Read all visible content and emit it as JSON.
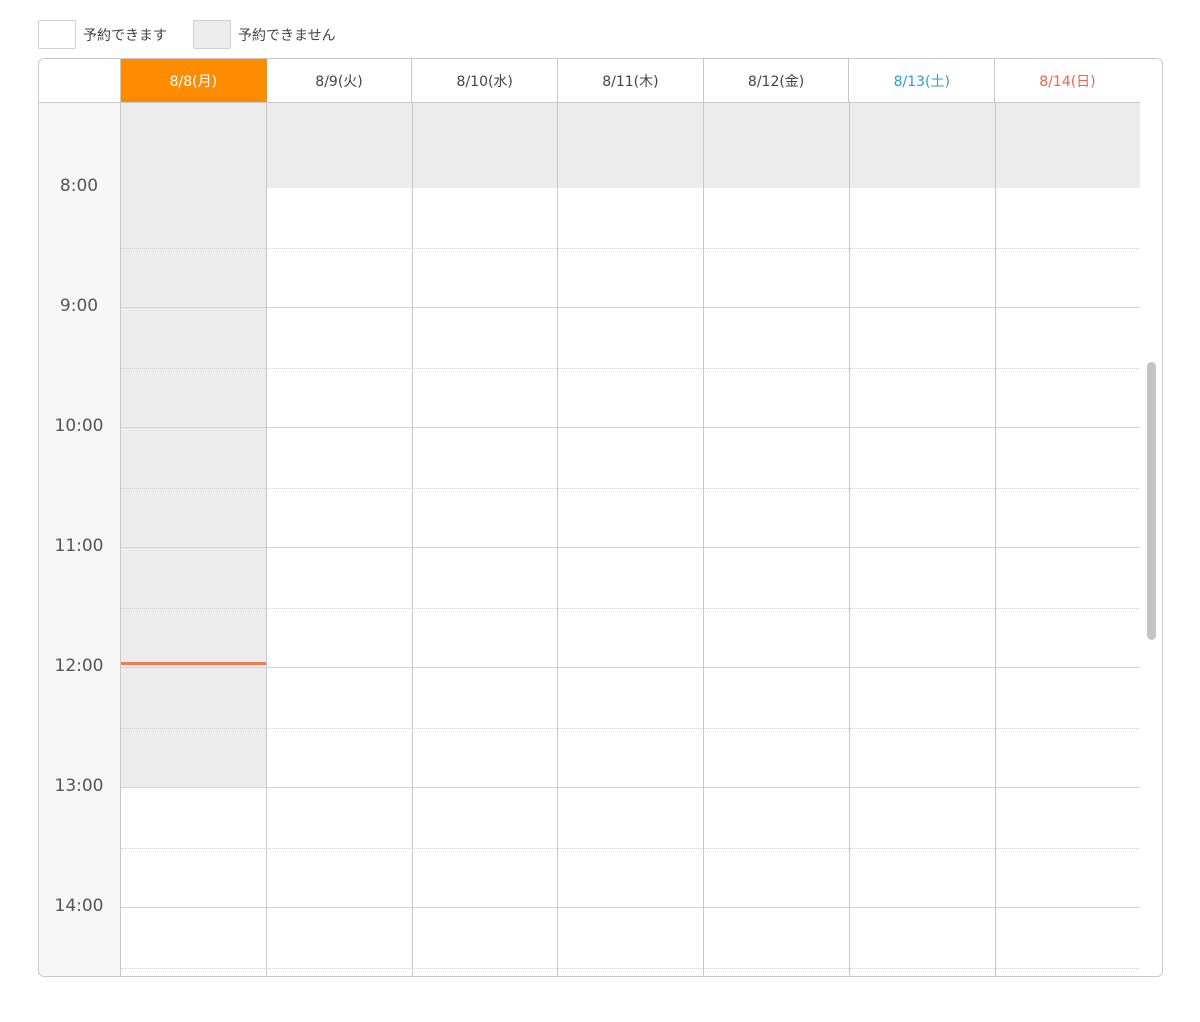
{
  "legend": {
    "available_label": "予約できます",
    "unavailable_label": "予約できません"
  },
  "colors": {
    "today": "#ff8c00",
    "saturday": "#2a9fd6",
    "sunday": "#f0624a",
    "unavailable": "#ececec",
    "now_line": "#f27a55"
  },
  "days": [
    {
      "label": "8/8(月)",
      "kind": "today"
    },
    {
      "label": "8/9(火)",
      "kind": "weekday"
    },
    {
      "label": "8/10(水)",
      "kind": "weekday"
    },
    {
      "label": "8/11(木)",
      "kind": "weekday"
    },
    {
      "label": "8/12(金)",
      "kind": "weekday"
    },
    {
      "label": "8/13(土)",
      "kind": "sat"
    },
    {
      "label": "8/14(日)",
      "kind": "sun"
    }
  ],
  "times": [
    "8:00",
    "9:00",
    "10:00",
    "11:00",
    "12:00",
    "13:00",
    "14:00"
  ]
}
